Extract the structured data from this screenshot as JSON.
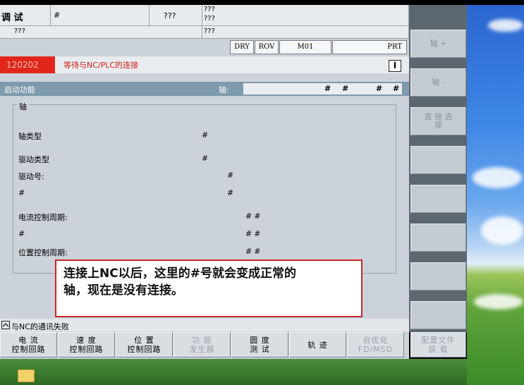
{
  "header": {
    "mode": "调 试",
    "field1": "#",
    "field2": "???",
    "field3a": "???",
    "field3b": "???",
    "row2_left": "???",
    "row2_right": "???",
    "status_boxes": [
      "DRY",
      "ROV",
      "M01",
      "PRT"
    ]
  },
  "alarm": {
    "number": "120202",
    "text": "等待与NC/PLC的连接",
    "ack": "I"
  },
  "section": {
    "title": "启动功能",
    "axis_label": "轴:",
    "axis_values": [
      "#",
      "#",
      "#",
      "#"
    ]
  },
  "group": {
    "label": "轴",
    "rows": [
      {
        "label": "轴类型",
        "value": "#"
      },
      {
        "label": "驱动类型",
        "value": "#"
      },
      {
        "label": "驱动号:",
        "value": "#"
      },
      {
        "label": "#",
        "value": "#"
      },
      {
        "label": "电流控制周期:",
        "value": "##"
      },
      {
        "label": "#",
        "value": "##"
      },
      {
        "label": "位置控制周期:",
        "value": "##"
      }
    ]
  },
  "tooltip": {
    "line1": "连接上NC以后，这里的#号就会变成正常的",
    "line2": "轴，现在是没有连接。"
  },
  "message": {
    "text": "与NC的通讯失败"
  },
  "softkeys_right": [
    {
      "label": "轴 +",
      "enabled": false
    },
    {
      "label": "轴 -",
      "enabled": false
    },
    {
      "label": "直 接 选 择",
      "enabled": false
    },
    {
      "label": "",
      "enabled": true
    },
    {
      "label": "",
      "enabled": true
    },
    {
      "label": "",
      "enabled": true
    },
    {
      "label": "",
      "enabled": true
    },
    {
      "label": "",
      "enabled": true
    }
  ],
  "softkeys_bottom": [
    {
      "line1": "电 流",
      "line2": "控制回路",
      "enabled": true
    },
    {
      "line1": "速 度",
      "line2": "控制回路",
      "enabled": true
    },
    {
      "line1": "位 置",
      "line2": "控制回路",
      "enabled": true
    },
    {
      "line1": "功 能",
      "line2": "发生器",
      "enabled": false
    },
    {
      "line1": "圆 度",
      "line2": "测 试",
      "enabled": true
    },
    {
      "line1": "轨 迹",
      "line2": "",
      "enabled": true
    },
    {
      "line1": "自优化",
      "line2": "FD/MSD",
      "enabled": false
    },
    {
      "line1": "配置文件",
      "line2": "装 载",
      "enabled": false
    }
  ]
}
